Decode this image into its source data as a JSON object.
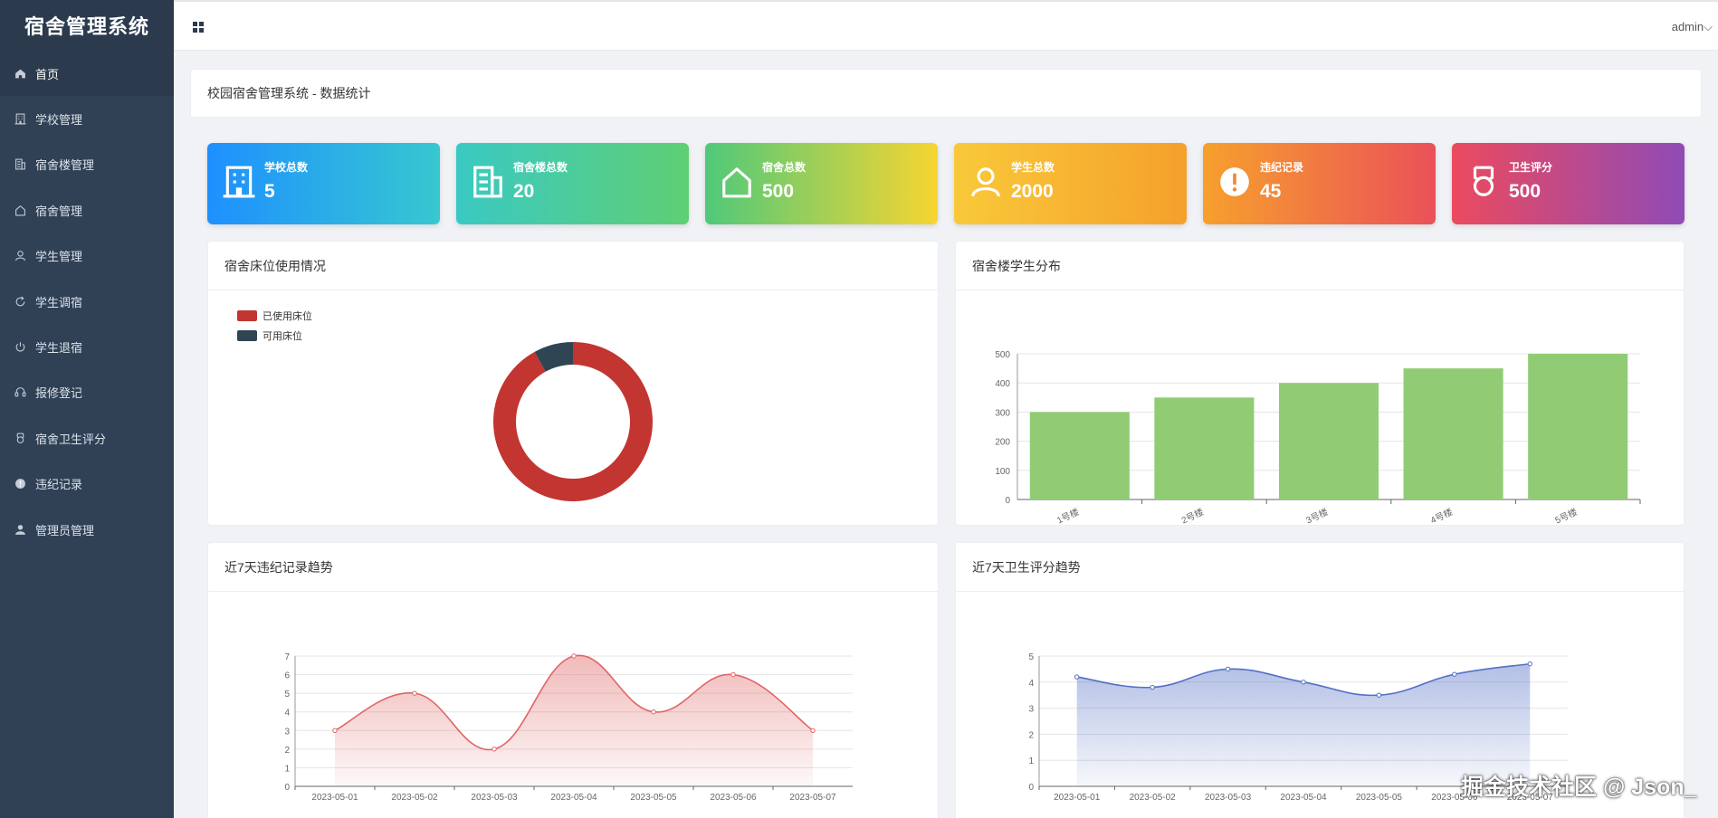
{
  "app": {
    "title": "宿舍管理系统"
  },
  "topbar": {
    "user": "admin"
  },
  "sidebar": {
    "items": [
      {
        "label": "首页",
        "icon": "home-icon",
        "active": true
      },
      {
        "label": "学校管理",
        "icon": "building-icon"
      },
      {
        "label": "宿舍楼管理",
        "icon": "office-building-icon"
      },
      {
        "label": "宿舍管理",
        "icon": "house-icon"
      },
      {
        "label": "学生管理",
        "icon": "user-icon"
      },
      {
        "label": "学生调宿",
        "icon": "refresh-icon"
      },
      {
        "label": "学生退宿",
        "icon": "power-icon"
      },
      {
        "label": "报修登记",
        "icon": "headset-icon"
      },
      {
        "label": "宿舍卫生评分",
        "icon": "medal-icon"
      },
      {
        "label": "违纪记录",
        "icon": "warning-icon"
      },
      {
        "label": "管理员管理",
        "icon": "admin-user-icon"
      }
    ]
  },
  "page": {
    "title": "校园宿舍管理系统 - 数据统计"
  },
  "stats": [
    {
      "label": "学校总数",
      "value": "5",
      "icon": "building-icon",
      "colors": [
        "#1e90ff",
        "#36c8d0"
      ]
    },
    {
      "label": "宿舍楼总数",
      "value": "20",
      "icon": "office-building-icon",
      "colors": [
        "#3ac9c3",
        "#5fcf74"
      ]
    },
    {
      "label": "宿舍总数",
      "value": "500",
      "icon": "house-icon",
      "colors": [
        "#4fc97a",
        "#f7d531"
      ]
    },
    {
      "label": "学生总数",
      "value": "2000",
      "icon": "user-icon",
      "colors": [
        "#f9c93a",
        "#f5a02b"
      ]
    },
    {
      "label": "违纪记录",
      "value": "45",
      "icon": "warning-icon",
      "colors": [
        "#f7a02d",
        "#ea5158"
      ]
    },
    {
      "label": "卫生评分",
      "value": "500",
      "icon": "medal-icon",
      "colors": [
        "#ec4a5e",
        "#8f4bb6"
      ]
    }
  ],
  "panels": {
    "beds": "宿舍床位使用情况",
    "buildings": "宿舍楼学生分布",
    "violations": "近7天违纪记录趋势",
    "hygiene": "近7天卫生评分趋势"
  },
  "chart_data": [
    {
      "type": "pie",
      "donut": true,
      "labels": [
        "已使用床位",
        "可用床位"
      ],
      "values": [
        92,
        8
      ],
      "colors": [
        "#c23531",
        "#2f4554"
      ],
      "legend": "top-left"
    },
    {
      "type": "bar",
      "categories": [
        "1号楼",
        "2号楼",
        "3号楼",
        "4号楼",
        "5号楼"
      ],
      "values": [
        300,
        350,
        400,
        450,
        500
      ],
      "ylim": [
        0,
        500
      ],
      "yticks": [
        0,
        100,
        200,
        300,
        400,
        500
      ],
      "color": "#91cc75",
      "grid": true
    },
    {
      "type": "area",
      "x": [
        "2023-05-01",
        "2023-05-02",
        "2023-05-03",
        "2023-05-04",
        "2023-05-05",
        "2023-05-06",
        "2023-05-07"
      ],
      "values": [
        3,
        5,
        2,
        7,
        4,
        6,
        3
      ],
      "ylim": [
        0,
        7
      ],
      "yticks": [
        0,
        1,
        2,
        3,
        4,
        5,
        6,
        7
      ],
      "color": "#e06666",
      "smooth": true,
      "grid": true
    },
    {
      "type": "area",
      "x": [
        "2023-05-01",
        "2023-05-02",
        "2023-05-03",
        "2023-05-04",
        "2023-05-05",
        "2023-05-06",
        "2023-05-07"
      ],
      "values": [
        4.2,
        3.8,
        4.5,
        4.0,
        3.5,
        4.3,
        4.7
      ],
      "ylim": [
        0,
        5
      ],
      "yticks": [
        0,
        1,
        2,
        3,
        4,
        5
      ],
      "color": "#5470c6",
      "smooth": true,
      "grid": true
    }
  ],
  "watermark": "掘金技术社区 @ Json_"
}
